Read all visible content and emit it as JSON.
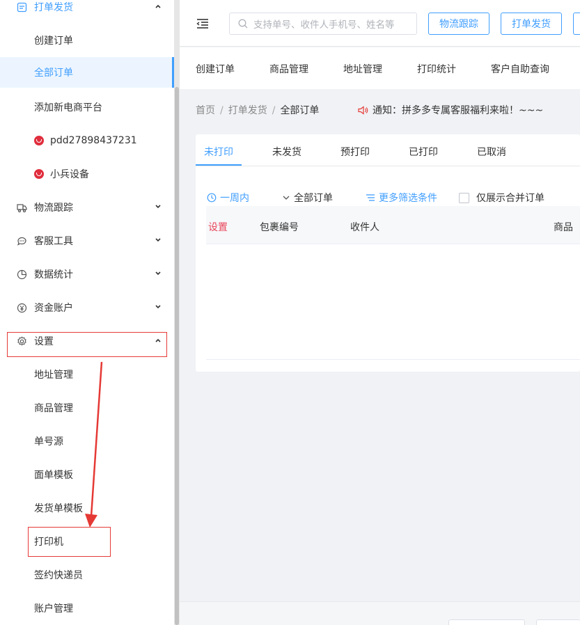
{
  "sidebar": {
    "group_shipping": "打单发货",
    "sub_create_order": "创建订单",
    "sub_all_orders": "全部订单",
    "sub_add_platform": "添加新电商平台",
    "shop_1": "pdd27898437231",
    "shop_2": "小兵设备",
    "logistics": "物流跟踪",
    "customer_service": "客服工具",
    "statistics": "数据统计",
    "funds": "资金账户",
    "settings": "设置",
    "settings_items": [
      "地址管理",
      "商品管理",
      "单号源",
      "面单模板",
      "发货单模板",
      "打印机",
      "签约快递员",
      "账户管理"
    ]
  },
  "header": {
    "search_placeholder": "支持单号、收件人手机号、姓名等",
    "btn_logistics": "物流跟踪",
    "btn_print": "打单发货"
  },
  "topnav": [
    "创建订单",
    "商品管理",
    "地址管理",
    "打印统计",
    "客户自助查询"
  ],
  "breadcrumb": {
    "home": "首页",
    "level1": "打单发货",
    "current": "全部订单",
    "sep": "/"
  },
  "notice": "通知：拼多多专属客服福利来啦！~~~",
  "tabs": [
    "未打印",
    "未发货",
    "预打印",
    "已打印",
    "已取消"
  ],
  "filters": {
    "period": "一周内",
    "all_orders": "全部订单",
    "more": "更多筛选条件",
    "merged_only": "仅展示合并订单"
  },
  "table": {
    "settings": "设置",
    "package_no": "包裹编号",
    "recipient": "收件人",
    "goods": "商品"
  },
  "colors": {
    "accent": "#409eff",
    "annotation": "#e53935",
    "pdd_badge": "#e02e3d"
  }
}
